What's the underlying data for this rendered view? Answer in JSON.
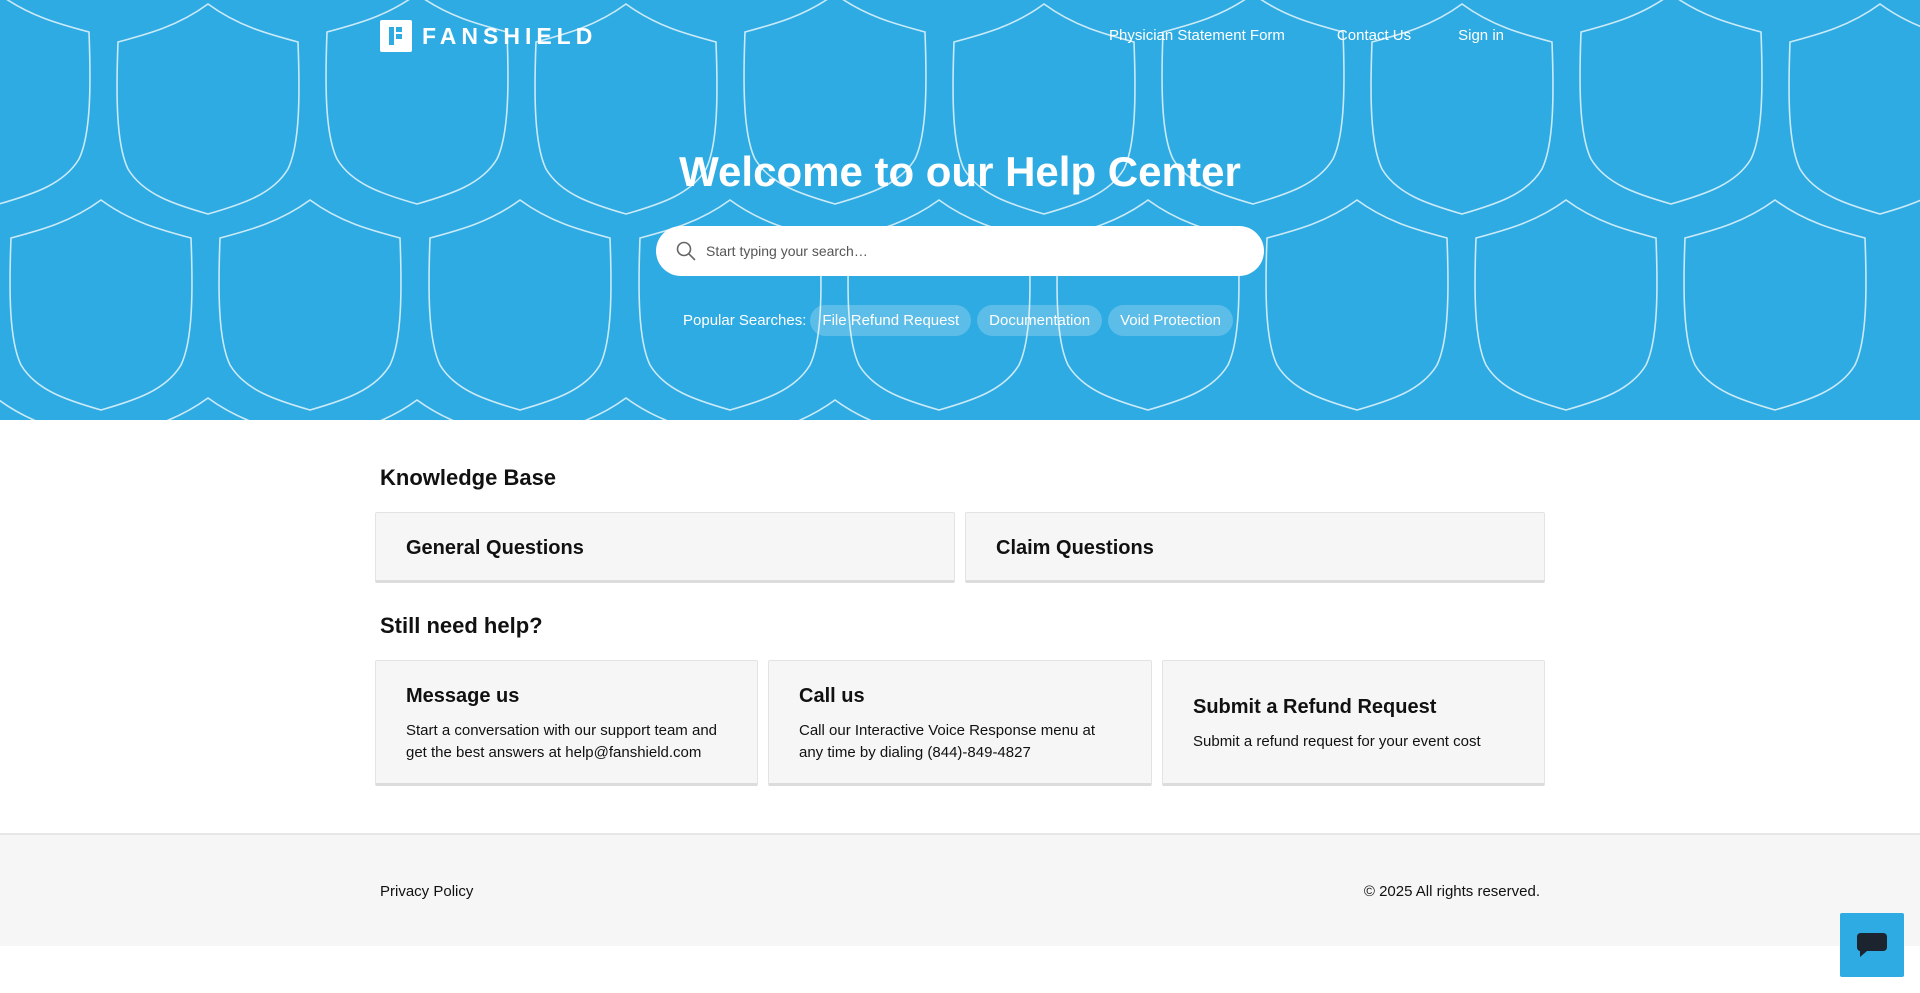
{
  "header": {
    "logo_text": "FANSHIELD",
    "nav": {
      "physician": "Physician Statement Form",
      "contact": "Contact Us",
      "signin": "Sign in"
    }
  },
  "hero": {
    "title": "Welcome to our Help Center",
    "search_placeholder": "Start typing your search…",
    "popular_label": "Popular Searches:",
    "popular": [
      "File Refund Request",
      "Documentation",
      "Void Protection"
    ]
  },
  "knowledge_base": {
    "title": "Knowledge Base",
    "cards": [
      "General Questions",
      "Claim Questions"
    ]
  },
  "help": {
    "title": "Still need help?",
    "cards": [
      {
        "title": "Message us",
        "text": "Start a conversation with our support team and get the best answers at help@fanshield.com"
      },
      {
        "title": "Call us",
        "text": "Call our Interactive Voice Response menu at any time by dialing (844)-849-4827"
      },
      {
        "title": "Submit a Refund Request",
        "text": "Submit a refund request for your event cost"
      }
    ]
  },
  "footer": {
    "privacy": "Privacy Policy",
    "copyright": "© 2025 All rights reserved."
  },
  "icons": [
    "search-icon",
    "chat-icon",
    "shield-pattern"
  ],
  "colors": {
    "brand": "#2eabe2"
  }
}
